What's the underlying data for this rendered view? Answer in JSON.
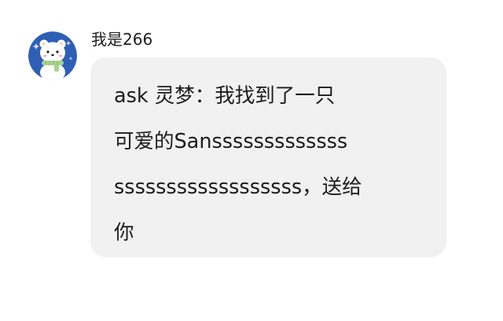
{
  "sender": {
    "name": "我是266",
    "avatar_icon": "white-bear-with-green-scarf-icon"
  },
  "message": {
    "lines": [
      "ask 灵梦：我找到了一只",
      "可爱的Sansssssssssssss",
      "ssssssssssssssssss，送给",
      "你"
    ]
  },
  "colors": {
    "avatar_background": "#2f5fb4",
    "bubble_background": "#f1f1f2",
    "scarf": "#a9d18e",
    "text": "#1c1c1c"
  }
}
